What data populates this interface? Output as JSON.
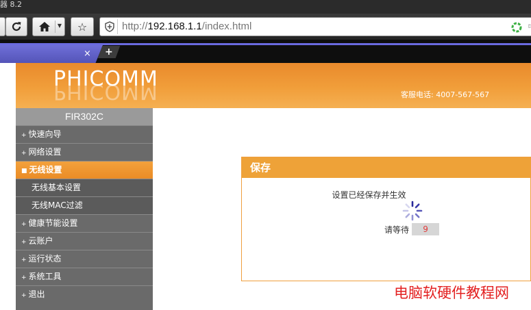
{
  "window": {
    "title": "器 8.2"
  },
  "toolbar": {
    "reload_icon": "reload-icon",
    "home_icon": "home-icon",
    "star_icon": "star-icon"
  },
  "address": {
    "prefix": "http://",
    "host": "192.168.1.1",
    "path": "/index.html"
  },
  "tabs": {
    "close_label": "×",
    "new_label": "+"
  },
  "header": {
    "logo": "PHICOMM",
    "hotline": "客服电话: 4007-567-567"
  },
  "sidebar": {
    "model": "FIR302C",
    "items": [
      {
        "label": "快速向导",
        "bullet": "+"
      },
      {
        "label": "网络设置",
        "bullet": "+"
      },
      {
        "label": "无线设置",
        "bullet": "■"
      },
      {
        "label": "无线基本设置"
      },
      {
        "label": "无线MAC过滤"
      },
      {
        "label": "健康节能设置",
        "bullet": "+"
      },
      {
        "label": "云账户",
        "bullet": "+"
      },
      {
        "label": "运行状态",
        "bullet": "+"
      },
      {
        "label": "系统工具",
        "bullet": "+"
      },
      {
        "label": "退出",
        "bullet": "+"
      }
    ]
  },
  "save_panel": {
    "title": "保存",
    "message": "设置已经保存并生效",
    "wait_label": "请等待",
    "countdown": "9"
  },
  "watermark": "电脑软硬件教程网",
  "colors": {
    "accent_orange": "#eea238",
    "tab_purple": "#6a6ae0",
    "countdown_red": "#e03a3a"
  }
}
